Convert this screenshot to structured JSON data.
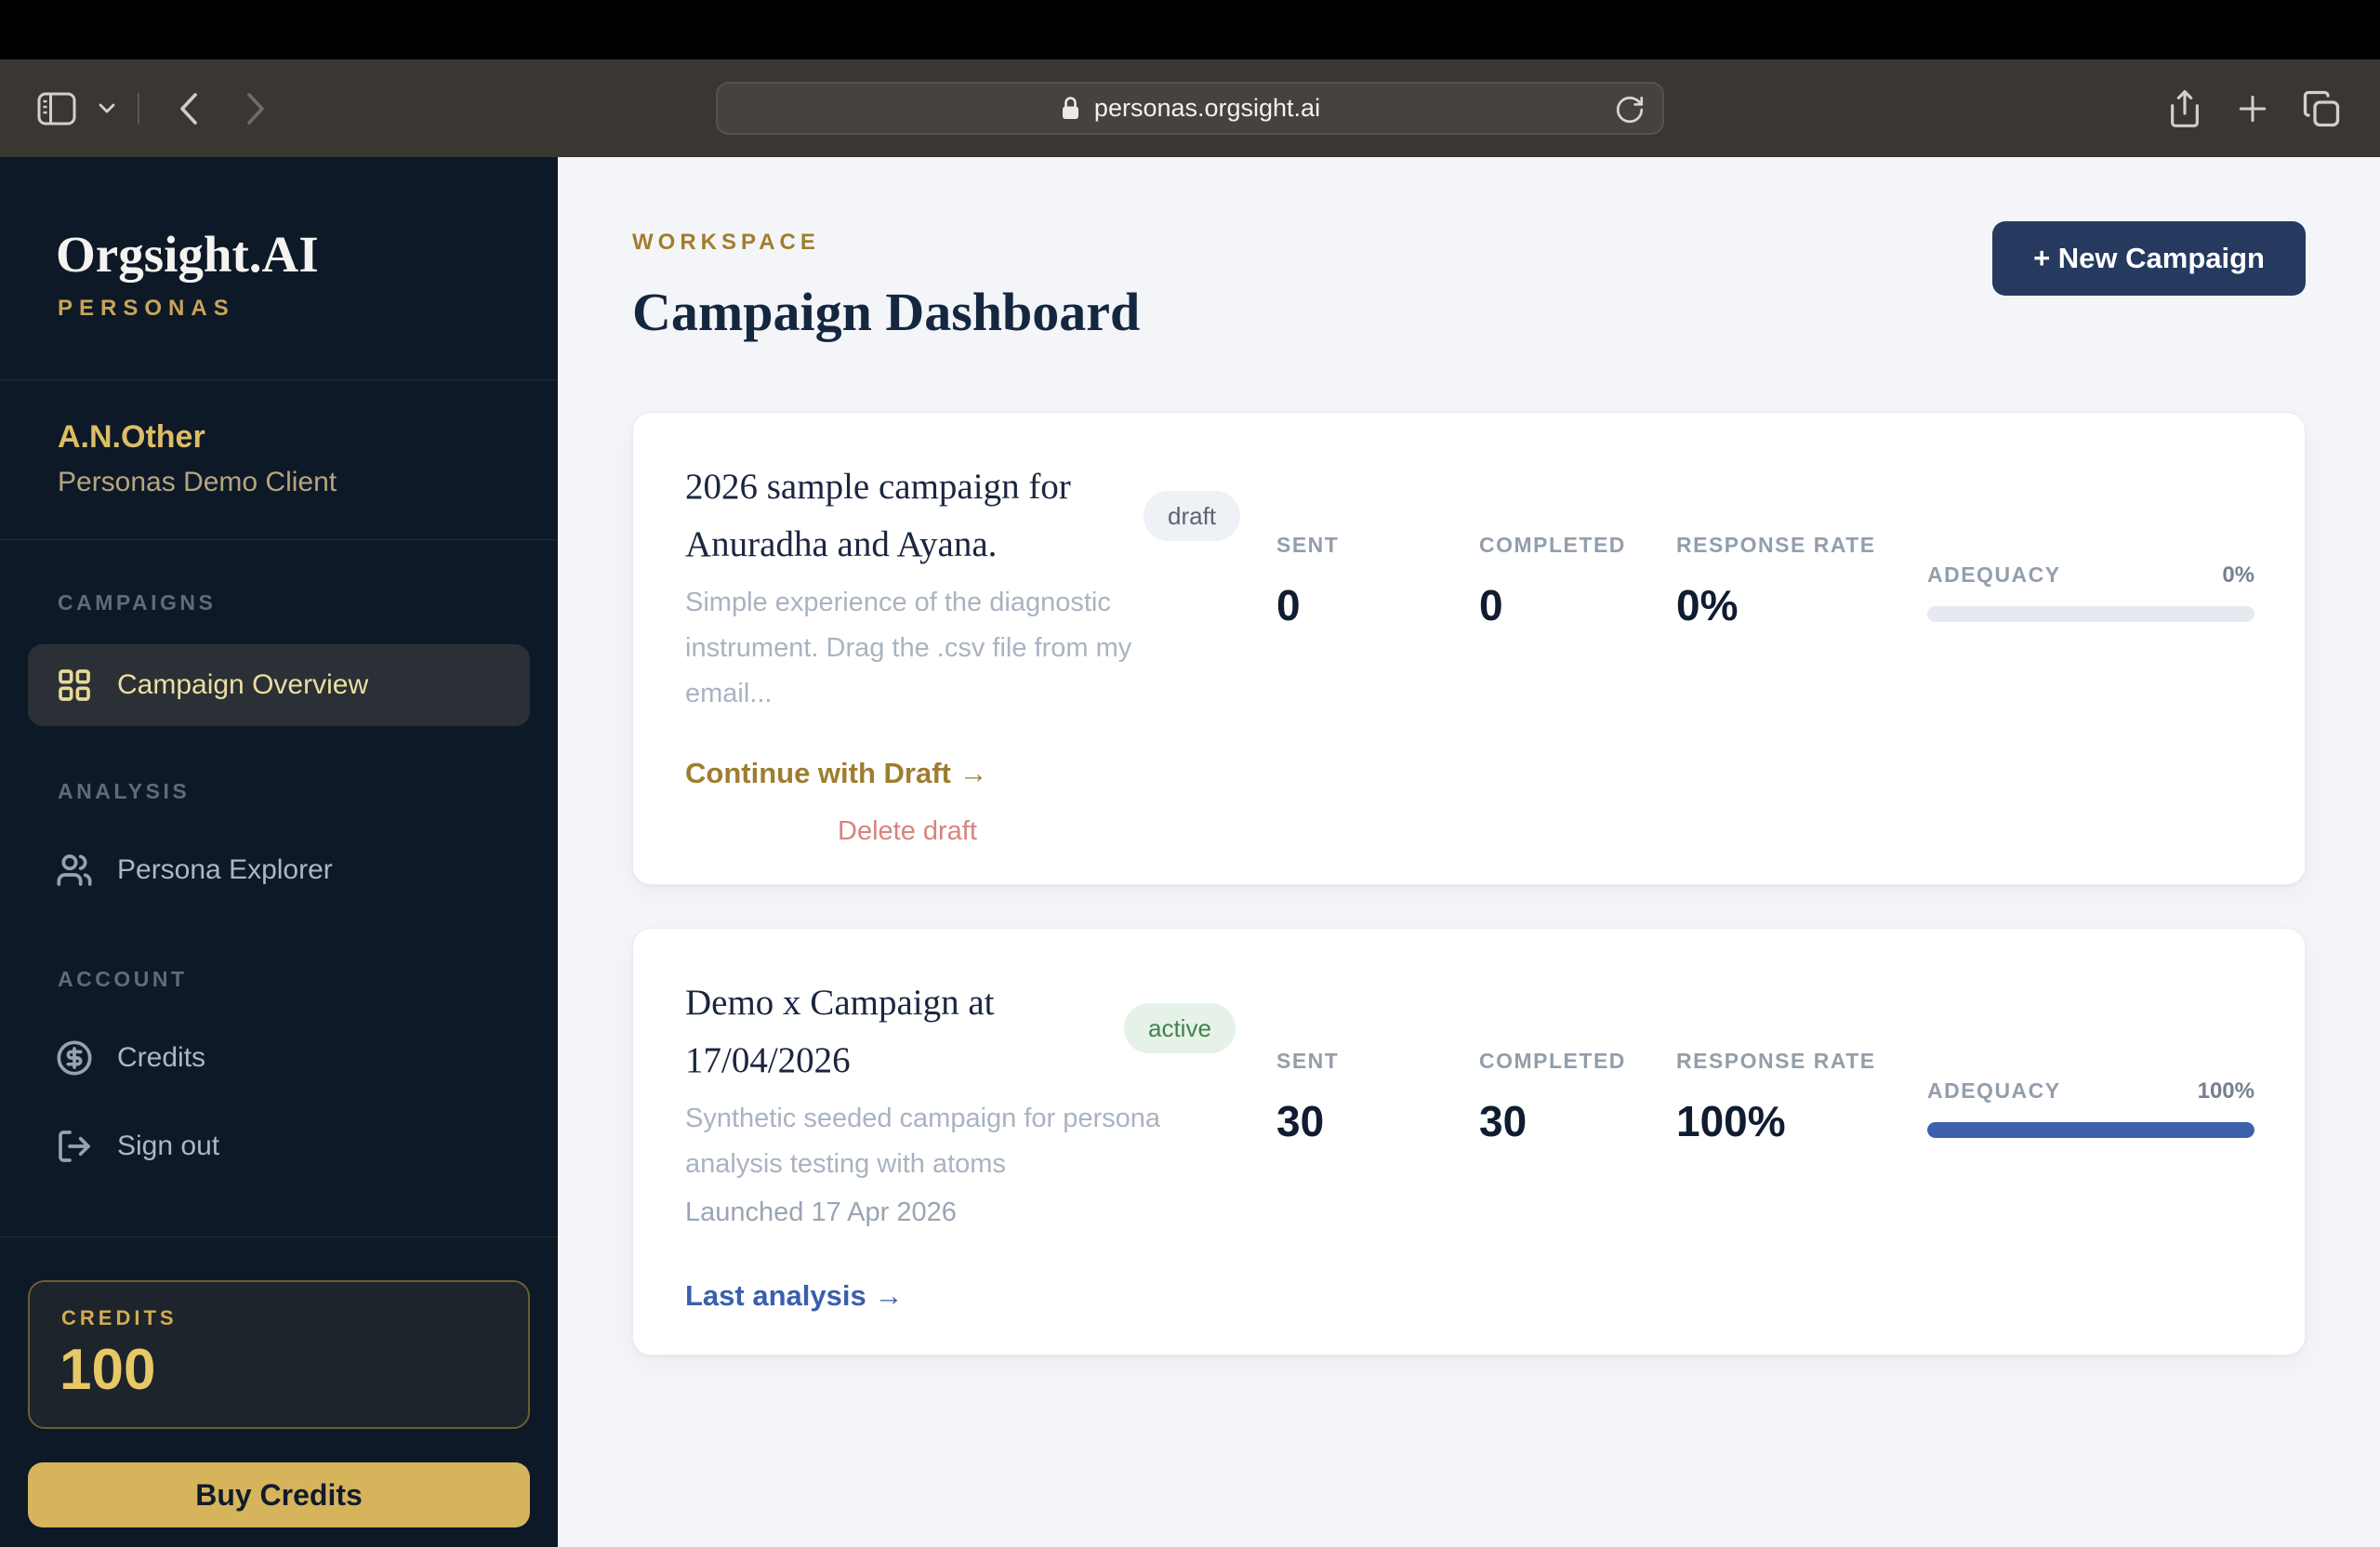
{
  "browser": {
    "url": "personas.orgsight.ai"
  },
  "sidebar": {
    "logo": "Orgsight.AI",
    "product": "PERSONAS",
    "client_name": "A.N.Other",
    "client_desc": "Personas Demo Client",
    "section_campaigns": "CAMPAIGNS",
    "section_analysis": "ANALYSIS",
    "section_account": "ACCOUNT",
    "nav_campaign_overview": "Campaign Overview",
    "nav_persona_explorer": "Persona Explorer",
    "nav_credits": "Credits",
    "nav_sign_out": "Sign out",
    "credits_label": "CREDITS",
    "credits_value": "100",
    "buy_credits": "Buy Credits"
  },
  "header": {
    "eyebrow": "WORKSPACE",
    "title": "Campaign Dashboard",
    "new_campaign": "+ New Campaign"
  },
  "stat_labels": {
    "sent": "SENT",
    "completed": "COMPLETED",
    "response_rate": "RESPONSE RATE",
    "adequacy": "ADEQUACY"
  },
  "cards": [
    {
      "title_line1": "2026 sample campaign for",
      "title_line2": "Anuradha and Ayana.",
      "status": "draft",
      "desc_line1": "Simple experience of the diagnostic",
      "desc_line2": "instrument. Drag the .csv file from my",
      "desc_line3": "email...",
      "sent": "0",
      "completed": "0",
      "response_rate": "0%",
      "adequacy": "0%",
      "adequacy_fill": 0,
      "primary_link": "Continue with Draft →",
      "secondary_link": "Delete draft"
    },
    {
      "title_line1": "Demo x Campaign at",
      "title_line2": "17/04/2026",
      "status": "active",
      "desc_line1": "Synthetic seeded campaign for persona",
      "desc_line2": "analysis testing with atoms",
      "meta": "Launched 17 Apr 2026",
      "sent": "30",
      "completed": "30",
      "response_rate": "100%",
      "adequacy": "100%",
      "adequacy_fill": 100,
      "primary_link": "Last analysis →"
    }
  ],
  "colors": {
    "sidebar_bg": "#0e1928",
    "gold_accent": "#d6b45c",
    "gold_text": "#c9a557",
    "navy_button": "#253a5e",
    "progress_blue": "#3d60ad",
    "link_blue": "#3a5fad",
    "gold_link": "#9e7d30",
    "danger_link": "#d8837e",
    "active_badge_bg": "#e6f2e7",
    "active_badge_text": "#41824e",
    "draft_badge_bg": "#eef1f5",
    "draft_badge_text": "#5b6572"
  }
}
